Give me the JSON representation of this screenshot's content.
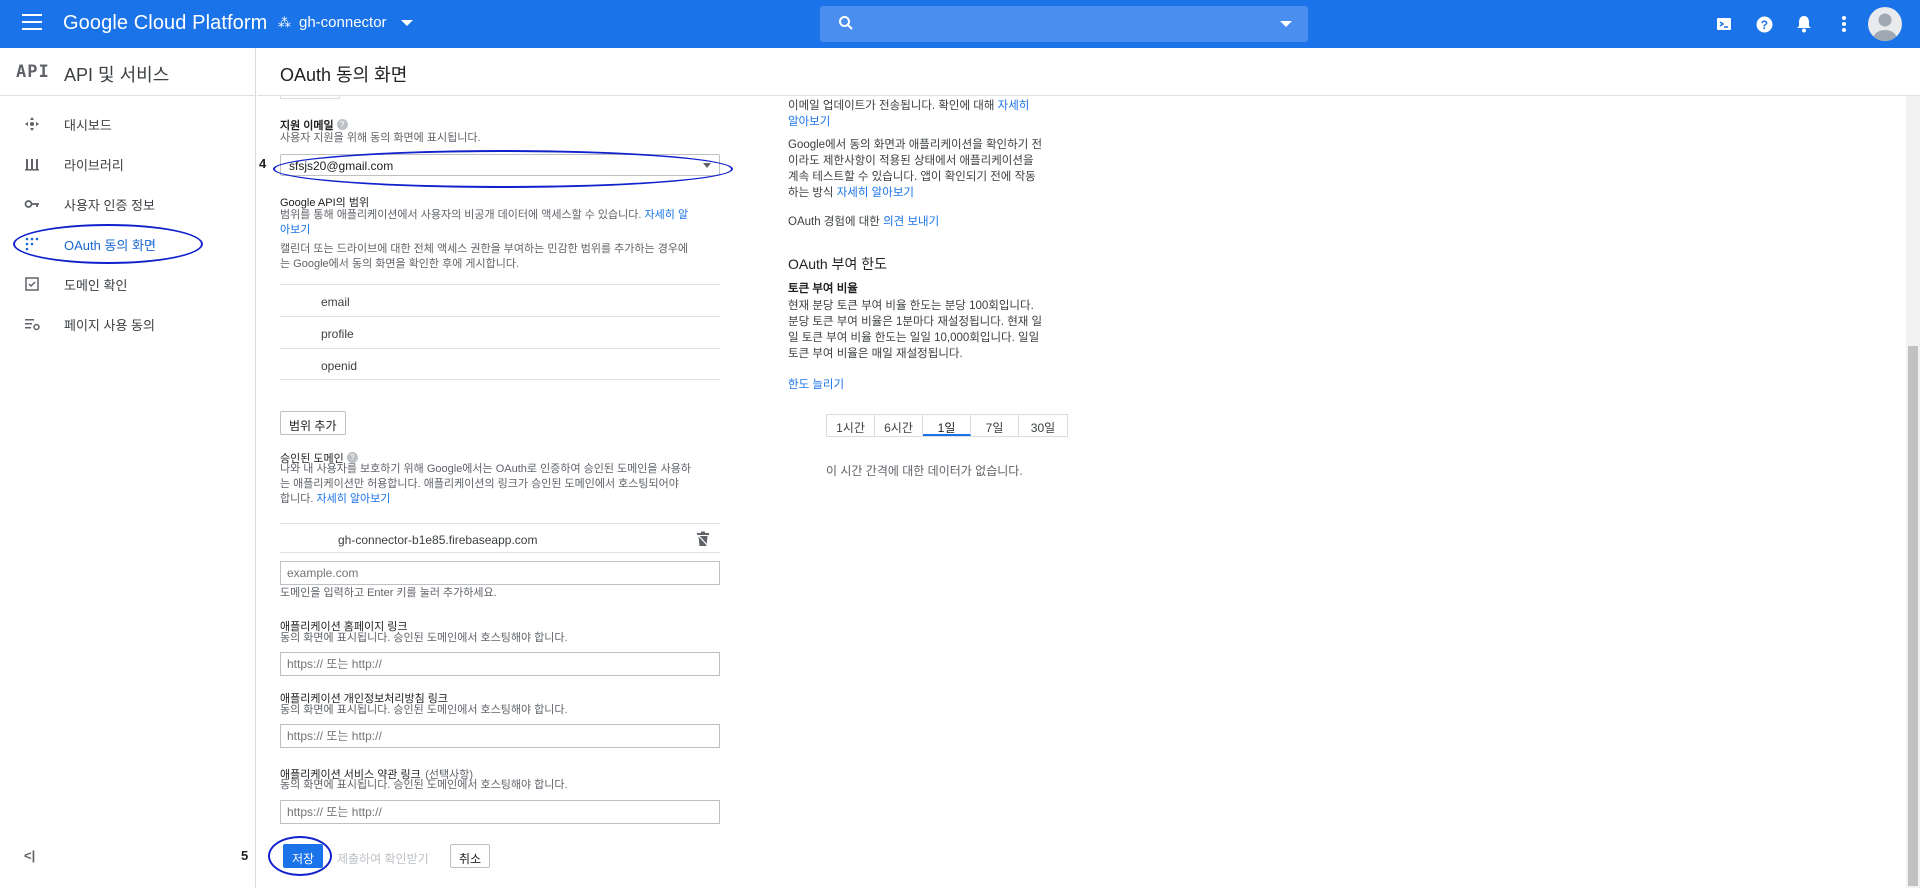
{
  "topbar": {
    "brand": "Google Cloud Platform",
    "project": "gh-connector",
    "icons": [
      "terminal-icon",
      "help-icon",
      "bell-icon",
      "more-vert-icon",
      "account-icon"
    ]
  },
  "sidebar": {
    "logo": "API",
    "title": "API 및 서비스",
    "items": [
      {
        "label": "대시보드",
        "icon": "dashboard-icon"
      },
      {
        "label": "라이브러리",
        "icon": "library-icon"
      },
      {
        "label": "사용자 인증 정보",
        "icon": "key-icon"
      },
      {
        "label": "OAuth 동의 화면",
        "icon": "oauth-icon"
      },
      {
        "label": "도메인 확인",
        "icon": "domain-check-icon"
      },
      {
        "label": "페이지 사용 동의",
        "icon": "settings-list-icon"
      }
    ],
    "active_index": 3,
    "collapse": "<|"
  },
  "header": {
    "title": "OAuth 동의 화면"
  },
  "form": {
    "support_email": {
      "label": "지원 이메일",
      "help": "사용자 지원을 위해 동의 화면에 표시됩니다.",
      "value": "sfsjs20@gmail.com"
    },
    "scopes": {
      "label": "Google API의 범위",
      "help1": "범위를 통해 애플리케이션에서 사용자의 비공개 데이터에 액세스할 수 있습니다. ",
      "help1_link_a": "자세히 알",
      "help1_link_b": "아보기",
      "help2a": "캘린더 또는 드라이브에 대한 전체 액세스 권한을 부여하는 민감한 범위를 추가하는 경우에",
      "help2b": "는 Google에서 동의 화면을 확인한 후에 게시합니다.",
      "items": [
        "email",
        "profile",
        "openid"
      ],
      "add_button": "범위 추가"
    },
    "authorized_domains": {
      "label": "승인된 도메인",
      "help_a": "나와 내 사용자를 보호하기 위해 Google에서는 OAuth로 인증하여 승인된 도메인을 사용하",
      "help_b": "는 애플리케이션만 허용합니다. 애플리케이션의 링크가 승인된 도메인에서 호스팅되어야",
      "help_c": "합니다. ",
      "help_link": "자세히 알아보기",
      "domain": "gh-connector-b1e85.firebaseapp.com",
      "placeholder": "example.com",
      "hint": "도메인을 입력하고 Enter 키를 눌러 추가하세요."
    },
    "homepage_link": {
      "label": "애플리케이션 홈페이지 링크",
      "help": "동의 화면에 표시됩니다. 승인된 도메인에서 호스팅해야 합니다.",
      "placeholder": "https:// 또는 http://"
    },
    "privacy_link": {
      "label": "애플리케이션 개인정보처리방침 링크",
      "help": "동의 화면에 표시됩니다. 승인된 도메인에서 호스팅해야 합니다.",
      "placeholder": "https:// 또는 http://"
    },
    "tos_link": {
      "label": "애플리케이션 서비스 약관 링크",
      "optional": "(선택사항)",
      "help": "동의 화면에 표시됩니다. 승인된 도메인에서 호스팅해야 합니다.",
      "placeholder": "https:// 또는 http://"
    },
    "buttons": {
      "save": "저장",
      "submit": "제출하여 확인받기",
      "cancel": "취소"
    }
  },
  "annotations": {
    "step4": "4",
    "step5": "5"
  },
  "right": {
    "p1_a": "이메일 업데이트가 전송됩니다. 확인에 대해 ",
    "p1_link_a": "자세히",
    "p1_link_b": "알아보기",
    "p2_a": "Google에서 동의 화면과 애플리케이션을 확인하기 전",
    "p2_b": "이라도 제한사항이 적용된 상태에서 애플리케이션을",
    "p2_c": "계속 테스트할 수 있습니다. 앱이 확인되기 전에 작동",
    "p2_d": "하는 방식 ",
    "p2_link": "자세히 알아보기",
    "feedback_a": "OAuth 경험에 대한 ",
    "feedback_link": "의견 보내기",
    "quota_title": "OAuth 부여 한도",
    "rate_title": "토큰 부여 비율",
    "rate_a": "현재 분당 토큰 부여 비율 한도는 분당 100회입니다.",
    "rate_b": "분당 토큰 부여 비율은 1분마다 재설정됩니다. 현재 일",
    "rate_c": "일 토큰 부여 비율 한도는 일일 10,000회입니다. 일일",
    "rate_d": "토큰 부여 비율은 매일 재설정됩니다.",
    "increase_link": "한도 늘리기",
    "tabs": [
      "1시간",
      "6시간",
      "1일",
      "7일",
      "30일"
    ],
    "active_tab": 2,
    "no_data": "이 시간 간격에 대한 데이터가 없습니다."
  }
}
